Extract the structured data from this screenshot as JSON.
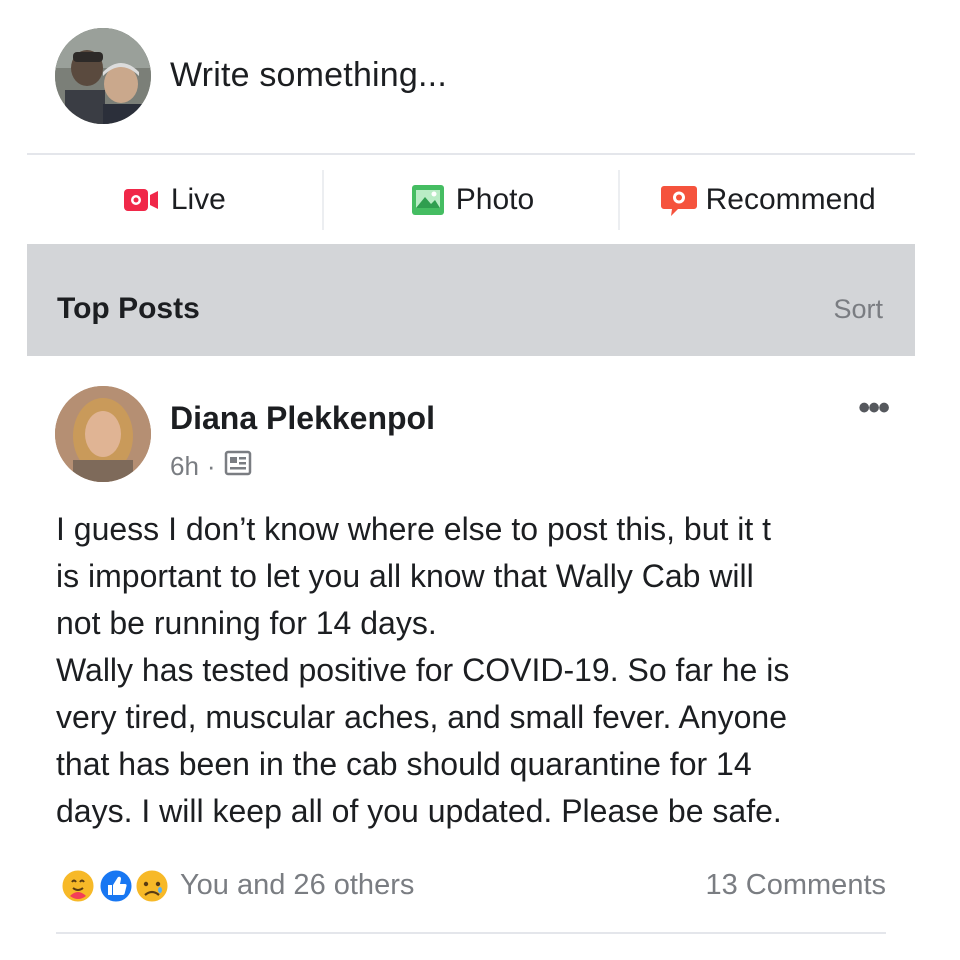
{
  "composer": {
    "placeholder": "Write something..."
  },
  "actions": [
    {
      "label": "Live",
      "icon": "live-video-icon",
      "color": "#f02849"
    },
    {
      "label": "Photo",
      "icon": "photo-icon",
      "color": "#45bd62"
    },
    {
      "label": "Recommend",
      "icon": "recommend-icon",
      "color": "#f5533d"
    }
  ],
  "section": {
    "title": "Top Posts",
    "sort_label": "Sort"
  },
  "post": {
    "author": "Diana Plekkenpol",
    "time": "6h",
    "separator": "·",
    "audience_icon": "group-icon",
    "body_lines": [
      "I guess I don’t know where else to post this, but it t",
      "is important to let you all know that Wally Cab will",
      "not be running for 14 days.",
      "Wally has tested positive for COVID-19. So far he is",
      "very tired, muscular aches, and small fever. Anyone",
      "that has been in the cab should quarantine for 14",
      "days. I will keep all of you updated. Please be safe."
    ],
    "reactions": {
      "icons": [
        "care-reaction-icon",
        "like-reaction-icon",
        "sad-reaction-icon"
      ],
      "summary": "You and 26 others"
    },
    "comments": "13 Comments"
  },
  "colors": {
    "section_bar": "#d3d5d8",
    "secondary_text": "#7a7d82",
    "like_blue": "#1877f2",
    "reaction_yellow": "#f7b928"
  }
}
